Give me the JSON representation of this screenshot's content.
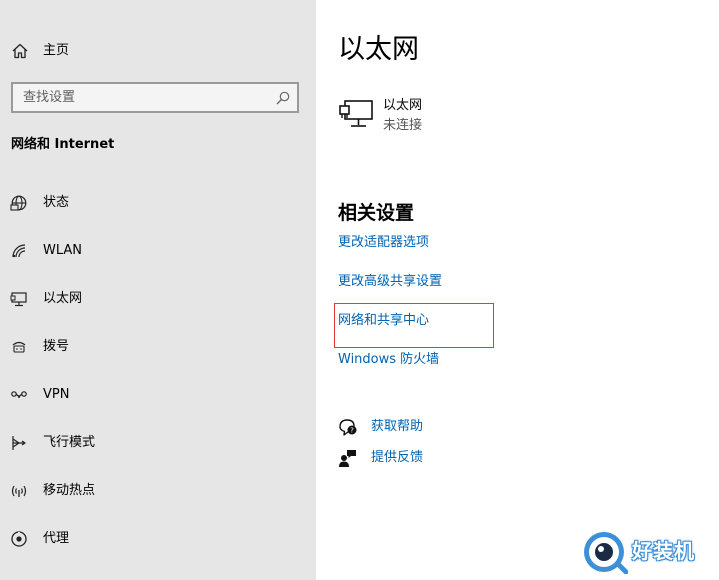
{
  "sidebar": {
    "home_label": "主页",
    "search_placeholder": "查找设置",
    "section_title": "网络和 Internet",
    "items": [
      {
        "label": "状态",
        "icon": "globe-icon"
      },
      {
        "label": "WLAN",
        "icon": "wifi-icon"
      },
      {
        "label": "以太网",
        "icon": "ethernet-icon"
      },
      {
        "label": "拨号",
        "icon": "dialup-icon"
      },
      {
        "label": "VPN",
        "icon": "vpn-icon"
      },
      {
        "label": "飞行模式",
        "icon": "airplane-icon"
      },
      {
        "label": "移动热点",
        "icon": "hotspot-icon"
      },
      {
        "label": "代理",
        "icon": "proxy-icon"
      }
    ]
  },
  "main": {
    "title": "以太网",
    "adapter": {
      "name": "以太网",
      "status": "未连接"
    },
    "related_title": "相关设置",
    "links": [
      "更改适配器选项",
      "更改高级共享设置",
      "网络和共享中心",
      "Windows 防火墙"
    ],
    "help": [
      {
        "label": "获取帮助",
        "icon": "help-icon"
      },
      {
        "label": "提供反馈",
        "icon": "feedback-icon"
      }
    ]
  },
  "watermark": {
    "text": "好装机"
  },
  "colors": {
    "sidebar_bg": "#e6e6e6",
    "link": "#0063b1",
    "highlight": "#e23a3a"
  }
}
